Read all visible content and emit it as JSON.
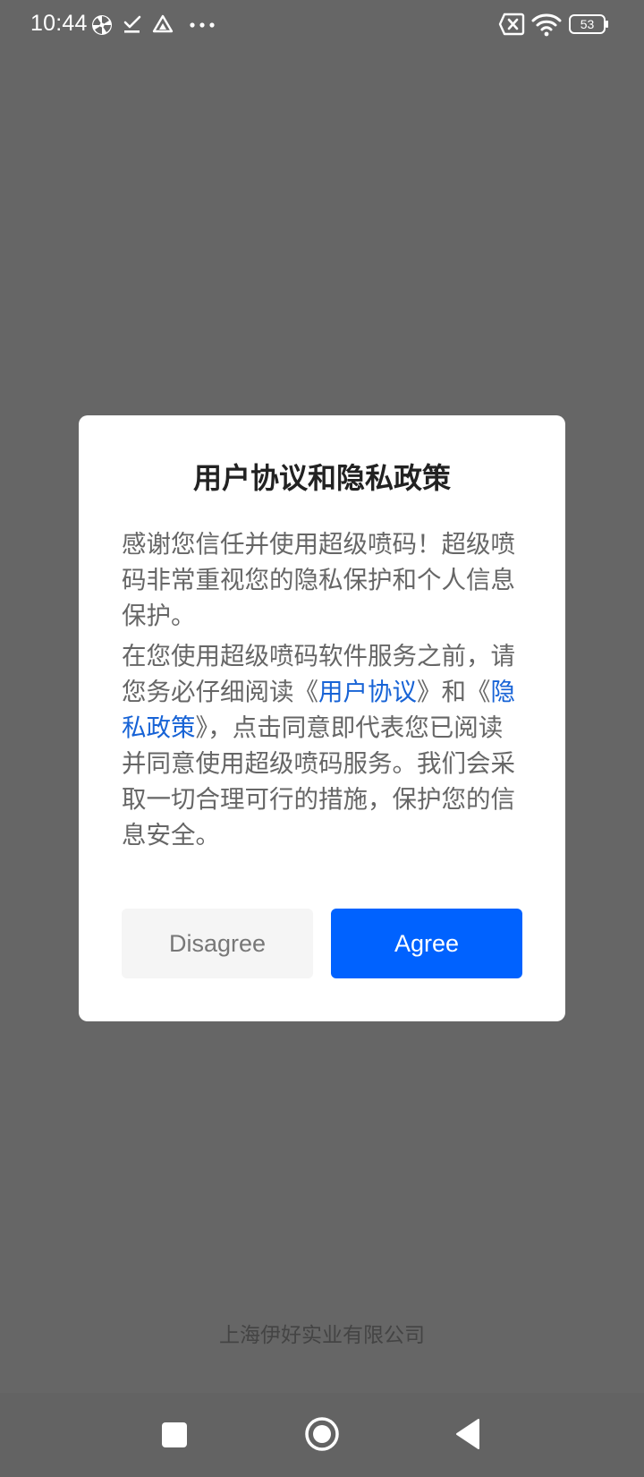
{
  "status_bar": {
    "time": "10:44",
    "battery": "53"
  },
  "dialog": {
    "title": "用户协议和隐私政策",
    "paragraph1": "感谢您信任并使用超级喷码！超级喷码非常重视您的隐私保护和个人信息保护。",
    "paragraph2": {
      "prefix": "在您使用超级喷码软件服务之前，请您务必仔细阅读《",
      "link_user_agreement": "用户协议",
      "middle": "》和《",
      "link_privacy_policy": "隐私政策",
      "suffix": "》，点击同意即代表您已阅读并同意使用超级喷码服务。我们会采取一切合理可行的措施，保护您的信息安全。"
    },
    "disagree_label": "Disagree",
    "agree_label": "Agree"
  },
  "footer": {
    "company": "上海伊好实业有限公司"
  },
  "icons": {
    "status": [
      "pinwheel-icon",
      "download-done-icon",
      "drive-icon",
      "more-dots-icon",
      "no-sim-icon",
      "wifi-icon",
      "battery-icon"
    ],
    "nav": [
      "recents-square-icon",
      "home-circle-icon",
      "back-triangle-icon"
    ]
  },
  "colors": {
    "overlay_background": "#666666",
    "dialog_background": "#ffffff",
    "primary_button": "#0062ff",
    "secondary_button": "#f5f5f5",
    "link": "#1763d6",
    "title_text": "#222222",
    "body_text": "#666666"
  }
}
